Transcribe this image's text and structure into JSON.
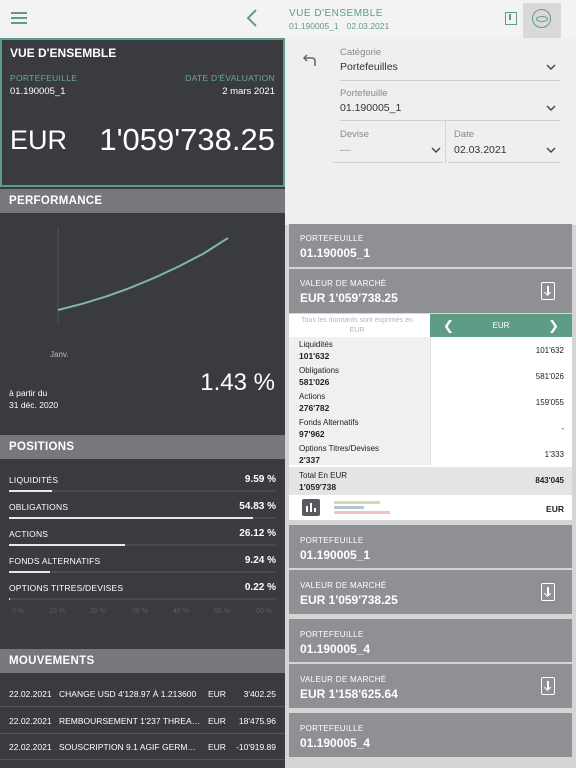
{
  "topbar": {
    "title": "VUE D'ENSEMBLE",
    "portfolio": "01.190005_1",
    "date": "02.03.2021"
  },
  "overview": {
    "title": "VUE D'ENSEMBLE",
    "portfolio_label": "PORTEFEUILLE",
    "portfolio_value": "01.190005_1",
    "date_label": "DATE D'ÉVALUATION",
    "date_value": "2 mars 2021",
    "currency": "EUR",
    "amount": "1'059'738.25"
  },
  "performance": {
    "title": "PERFORMANCE",
    "x_label": "Janv.",
    "from_label": "à partir du",
    "from_date": "31 déc. 2020",
    "value": "1.43 %",
    "line_color": "#7fb8a3",
    "series": [
      0.0,
      0.2,
      0.4,
      0.6,
      0.8,
      1.0,
      1.2,
      1.43
    ]
  },
  "positions": {
    "title": "POSITIONS",
    "items": [
      {
        "name": "LIQUIDITÉS",
        "value": "9.59 %",
        "pct": 9.59
      },
      {
        "name": "OBLIGATIONS",
        "value": "54.83 %",
        "pct": 54.83
      },
      {
        "name": "ACTIONS",
        "value": "26.12 %",
        "pct": 26.12
      },
      {
        "name": "FONDS ALTERNATIFS",
        "value": "9.24 %",
        "pct": 9.24
      },
      {
        "name": "OPTIONS TITRES/DEVISES",
        "value": "0.22 %",
        "pct": 0.22
      }
    ],
    "axis": [
      "0 %",
      "10 %",
      "20 %",
      "30 %",
      "40 %",
      "50 %",
      "60 %"
    ]
  },
  "movements": {
    "title": "MOUVEMENTS",
    "rows": [
      {
        "date": "22.02.2021",
        "desc": "CHANGE USD 4'128.97 À 1.213600",
        "cur": "EUR",
        "amount": "3'402.25"
      },
      {
        "date": "22.02.2021",
        "desc": "REMBOURSEMENT 1'237 THREAD E…",
        "cur": "EUR",
        "amount": "18'475.96"
      },
      {
        "date": "22.02.2021",
        "desc": "SOUSCRIPTION 9.1 AGIF GERMAN …",
        "cur": "EUR",
        "amount": "-10'919.89"
      }
    ]
  },
  "filters": {
    "category_label": "Catégorie",
    "category_value": "Portefeuilles",
    "portfolio_label": "Portefeuille",
    "portfolio_value": "01.190005_1",
    "currency_label": "Devise",
    "currency_value": "—",
    "date_label": "Date",
    "date_value": "02.03.2021"
  },
  "cards": {
    "c1": {
      "label": "PORTEFEUILLE",
      "value": "01.190005_1"
    },
    "c2": {
      "label": "VALEUR DE MARCHÉ",
      "value": "EUR 1'059'738.25"
    },
    "c3": {
      "label": "PORTEFEUILLE",
      "value": "01.190005_1"
    },
    "c4": {
      "label": "VALEUR DE MARCHÉ",
      "value": "EUR 1'059'738.25"
    },
    "c5": {
      "label": "PORTEFEUILLE",
      "value": "01.190005_4"
    },
    "c6": {
      "label": "VALEUR DE MARCHÉ",
      "value": "EUR 1'158'625.64"
    },
    "c7": {
      "label": "PORTEFEUILLE",
      "value": "01.190005_4"
    }
  },
  "detail": {
    "note": "Tous les montants sont exprimés en EUR",
    "nav_currency": "EUR",
    "rows": [
      {
        "name": "Liquidités",
        "amount": "101'632",
        "right": "101'632"
      },
      {
        "name": "Obligations",
        "amount": "581'026",
        "right": "581'026"
      },
      {
        "name": "Actions",
        "amount": "276'782",
        "right": "159'055"
      },
      {
        "name": "Fonds Alternatifs",
        "amount": "97'962",
        "right": "-"
      },
      {
        "name": "Options Titres/Devises",
        "amount": "2'337",
        "right": "1'333"
      }
    ],
    "total": {
      "name": "Total En EUR",
      "amount": "1'059'738",
      "right": "843'045"
    },
    "footer_currency": "EUR"
  }
}
